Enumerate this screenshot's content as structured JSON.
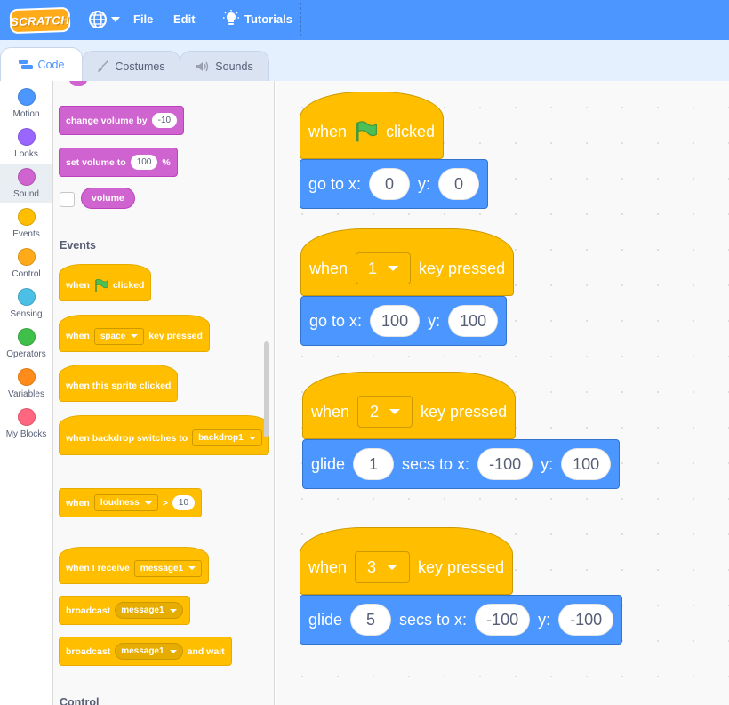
{
  "menubar": {
    "logo": "SCRATCH",
    "file": "File",
    "edit": "Edit",
    "tutorials": "Tutorials",
    "accent": "#4c97ff"
  },
  "tabs": [
    {
      "label": "Code",
      "active": true,
      "icon": "code-icon"
    },
    {
      "label": "Costumes",
      "active": false,
      "icon": "brush-icon"
    },
    {
      "label": "Sounds",
      "active": false,
      "icon": "speaker-icon"
    }
  ],
  "categories": [
    {
      "label": "Motion",
      "color": "#4c97ff"
    },
    {
      "label": "Looks",
      "color": "#9966ff"
    },
    {
      "label": "Sound",
      "color": "#cf63cf",
      "active": true
    },
    {
      "label": "Events",
      "color": "#ffbf00"
    },
    {
      "label": "Control",
      "color": "#ffab19"
    },
    {
      "label": "Sensing",
      "color": "#4cbfe6"
    },
    {
      "label": "Operators",
      "color": "#40bf4a"
    },
    {
      "label": "Variables",
      "color": "#ff8c1a"
    },
    {
      "label": "My Blocks",
      "color": "#ff6680"
    }
  ],
  "palette": {
    "change_volume": {
      "label": "change volume by",
      "value": "-10"
    },
    "set_volume": {
      "label": "set volume to",
      "value": "100",
      "unit": "%"
    },
    "volume_reporter": "volume",
    "events_heading": "Events",
    "when_flag": {
      "pre": "when",
      "post": "clicked"
    },
    "when_key": {
      "pre": "when",
      "key": "space",
      "post": "key pressed"
    },
    "when_sprite_clicked": "when this sprite clicked",
    "when_backdrop": {
      "pre": "when backdrop switches to",
      "value": "backdrop1"
    },
    "when_loudness": {
      "pre": "when",
      "value": "loudness",
      "op": ">",
      "num": "10"
    },
    "when_receive": {
      "pre": "when I receive",
      "value": "message1"
    },
    "broadcast": {
      "pre": "broadcast",
      "value": "message1"
    },
    "broadcast_wait": {
      "pre": "broadcast",
      "value": "message1",
      "post": "and wait"
    },
    "control_heading": "Control"
  },
  "scripts": [
    {
      "hat": {
        "pre": "when",
        "post": "clicked"
      },
      "motion": {
        "label": "go to x:",
        "x": "0",
        "ylabel": "y:",
        "y": "0"
      }
    },
    {
      "hat": {
        "pre": "when",
        "key": "1",
        "post": "key pressed"
      },
      "motion": {
        "label": "go to x:",
        "x": "100",
        "ylabel": "y:",
        "y": "100"
      }
    },
    {
      "hat": {
        "pre": "when",
        "key": "2",
        "post": "key pressed"
      },
      "motion": {
        "label": "glide",
        "secs": "1",
        "mid": "secs to x:",
        "x": "-100",
        "ylabel": "y:",
        "y": "100"
      }
    },
    {
      "hat": {
        "pre": "when",
        "key": "3",
        "post": "key pressed"
      },
      "motion": {
        "label": "glide",
        "secs": "5",
        "mid": "secs to x:",
        "x": "-100",
        "ylabel": "y:",
        "y": "-100"
      }
    }
  ]
}
